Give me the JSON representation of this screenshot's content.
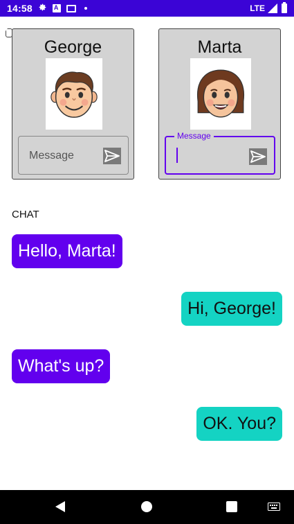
{
  "status_bar": {
    "time": "14:58",
    "network": "LTE",
    "icons": [
      "gear-icon",
      "a-icon",
      "mail-icon",
      "sd-card-icon",
      "dot-icon",
      "signal-icon",
      "battery-icon"
    ]
  },
  "george_panel": {
    "name": "George",
    "message_placeholder": "Message",
    "avatar_icon": "boy-avatar-icon",
    "send_icon": "send-icon"
  },
  "marta_panel": {
    "name": "Marta",
    "message_label": "Message",
    "message_value": "",
    "avatar_icon": "girl-avatar-icon",
    "send_icon": "send-icon"
  },
  "chat": {
    "label": "CHAT",
    "messages": [
      {
        "sender": "George",
        "text": "Hello, Marta!"
      },
      {
        "sender": "Marta",
        "text": "Hi, George!"
      },
      {
        "sender": "George",
        "text": "What's up?"
      },
      {
        "sender": "Marta",
        "text": "OK. You?"
      }
    ]
  },
  "colors": {
    "status_bar": "#3b04d6",
    "george_bubble": "#6200ee",
    "marta_bubble": "#14d3c3",
    "card_bg": "#d3d3d3"
  },
  "nav_bar": {
    "icons": [
      "back-icon",
      "home-icon",
      "recents-icon",
      "keyboard-icon"
    ]
  }
}
